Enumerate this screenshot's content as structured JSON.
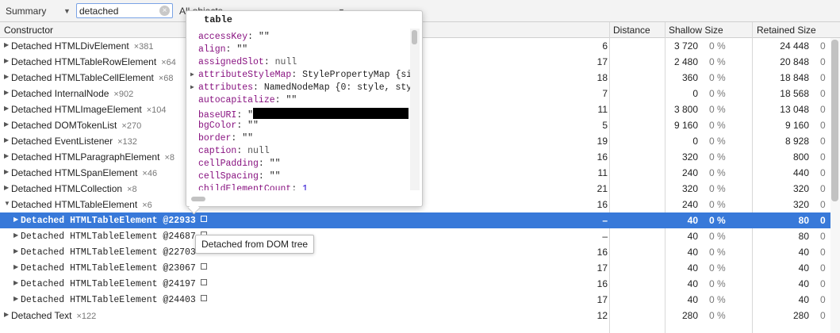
{
  "toolbar": {
    "view_label": "Summary",
    "search_value": "detached",
    "filter_label": "All objects"
  },
  "columns": {
    "constructor": "Constructor",
    "distance": "Distance",
    "shallow": "Shallow Size",
    "retained": "Retained Size"
  },
  "groups": [
    {
      "name": "Detached HTMLDivElement",
      "count": "×381",
      "distance": "6",
      "shallow": "3 720",
      "shallow_pct": "0 %",
      "retained": "24 448",
      "retained_pct": "0"
    },
    {
      "name": "Detached HTMLTableRowElement",
      "count": "×64",
      "distance": "17",
      "shallow": "2 480",
      "shallow_pct": "0 %",
      "retained": "20 848",
      "retained_pct": "0"
    },
    {
      "name": "Detached HTMLTableCellElement",
      "count": "×68",
      "distance": "18",
      "shallow": "360",
      "shallow_pct": "0 %",
      "retained": "18 848",
      "retained_pct": "0"
    },
    {
      "name": "Detached InternalNode",
      "count": "×902",
      "distance": "7",
      "shallow": "0",
      "shallow_pct": "0 %",
      "retained": "18 568",
      "retained_pct": "0"
    },
    {
      "name": "Detached HTMLImageElement",
      "count": "×104",
      "distance": "11",
      "shallow": "3 800",
      "shallow_pct": "0 %",
      "retained": "13 048",
      "retained_pct": "0"
    },
    {
      "name": "Detached DOMTokenList",
      "count": "×270",
      "distance": "5",
      "shallow": "9 160",
      "shallow_pct": "0 %",
      "retained": "9 160",
      "retained_pct": "0"
    },
    {
      "name": "Detached EventListener",
      "count": "×132",
      "distance": "19",
      "shallow": "0",
      "shallow_pct": "0 %",
      "retained": "8 928",
      "retained_pct": "0"
    },
    {
      "name": "Detached HTMLParagraphElement",
      "count": "×8",
      "distance": "16",
      "shallow": "320",
      "shallow_pct": "0 %",
      "retained": "800",
      "retained_pct": "0"
    },
    {
      "name": "Detached HTMLSpanElement",
      "count": "×46",
      "distance": "11",
      "shallow": "240",
      "shallow_pct": "0 %",
      "retained": "440",
      "retained_pct": "0"
    },
    {
      "name": "Detached HTMLCollection",
      "count": "×8",
      "distance": "21",
      "shallow": "320",
      "shallow_pct": "0 %",
      "retained": "320",
      "retained_pct": "0"
    },
    {
      "name": "Detached HTMLTableElement",
      "count": "×6",
      "distance": "16",
      "shallow": "240",
      "shallow_pct": "0 %",
      "retained": "320",
      "retained_pct": "0"
    }
  ],
  "instances": [
    {
      "name": "Detached HTMLTableElement @22933",
      "distance": "–",
      "shallow": "40",
      "shallow_pct": "0 %",
      "retained": "80",
      "retained_pct": "0"
    },
    {
      "name": "Detached HTMLTableElement @24687",
      "distance": "–",
      "shallow": "40",
      "shallow_pct": "0 %",
      "retained": "80",
      "retained_pct": "0"
    },
    {
      "name": "Detached HTMLTableElement @22703",
      "distance": "16",
      "shallow": "40",
      "shallow_pct": "0 %",
      "retained": "40",
      "retained_pct": "0"
    },
    {
      "name": "Detached HTMLTableElement @23067",
      "distance": "17",
      "shallow": "40",
      "shallow_pct": "0 %",
      "retained": "40",
      "retained_pct": "0"
    },
    {
      "name": "Detached HTMLTableElement @24197",
      "distance": "16",
      "shallow": "40",
      "shallow_pct": "0 %",
      "retained": "40",
      "retained_pct": "0"
    },
    {
      "name": "Detached HTMLTableElement @24403",
      "distance": "17",
      "shallow": "40",
      "shallow_pct": "0 %",
      "retained": "40",
      "retained_pct": "0"
    }
  ],
  "after_groups": [
    {
      "name": "Detached Text",
      "count": "×122",
      "distance": "12",
      "shallow": "280",
      "shallow_pct": "0 %",
      "retained": "280",
      "retained_pct": "0"
    }
  ],
  "popover": {
    "title": "table",
    "props": [
      {
        "key": "accessKey",
        "value": "\"\""
      },
      {
        "key": "align",
        "value": "\"\""
      },
      {
        "key": "assignedSlot",
        "value": "null"
      },
      {
        "key": "attributeStyleMap",
        "value": "StylePropertyMap {siz"
      },
      {
        "key": "attributes",
        "value": "NamedNodeMap {0: style, styl"
      },
      {
        "key": "autocapitalize",
        "value": "\"\""
      },
      {
        "key": "baseURI",
        "value": "\""
      },
      {
        "key": "bgColor",
        "value": "\"\""
      },
      {
        "key": "border",
        "value": "\"\""
      },
      {
        "key": "caption",
        "value": "null"
      },
      {
        "key": "cellPadding",
        "value": "\"\""
      },
      {
        "key": "cellSpacing",
        "value": "\"\""
      },
      {
        "key": "childElementCount",
        "value": "1"
      }
    ]
  },
  "tooltip": "Detached from DOM tree"
}
